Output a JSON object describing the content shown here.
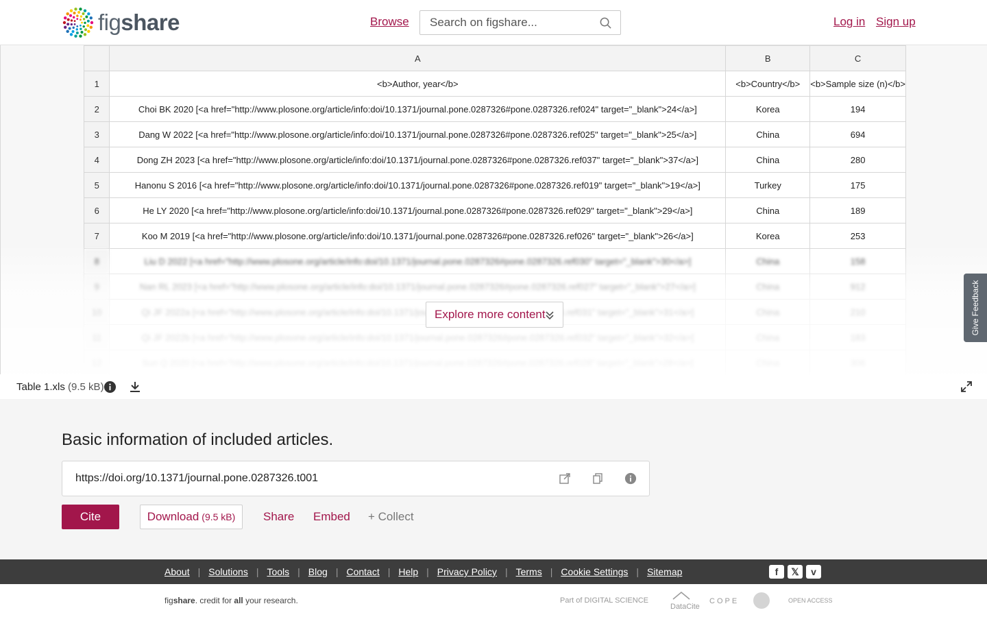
{
  "header": {
    "logo_prefix": "fig",
    "logo_suffix": "share",
    "browse_label": "Browse",
    "search_placeholder": "Search on figshare...",
    "login_label": "Log in",
    "signup_label": "Sign up"
  },
  "sheet": {
    "columns": [
      "A",
      "B",
      "C"
    ],
    "rows": [
      {
        "n": "1",
        "a": "<b>Author, year</b>",
        "b": "<b>Country</b>",
        "c": "<b>Sample size (n)</b>"
      },
      {
        "n": "2",
        "a": "Choi BK 2020 [<a href=\"http://www.plosone.org/article/info:doi/10.1371/journal.pone.0287326#pone.0287326.ref024\" target=\"_blank\">24</a>]",
        "b": "Korea",
        "c": "194"
      },
      {
        "n": "3",
        "a": "Dang W 2022 [<a href=\"http://www.plosone.org/article/info:doi/10.1371/journal.pone.0287326#pone.0287326.ref025\" target=\"_blank\">25</a>]",
        "b": "China",
        "c": "694"
      },
      {
        "n": "4",
        "a": "Dong ZH 2023 [<a href=\"http://www.plosone.org/article/info:doi/10.1371/journal.pone.0287326#pone.0287326.ref037\" target=\"_blank\">37</a>]",
        "b": "China",
        "c": "280"
      },
      {
        "n": "5",
        "a": "Hanonu S 2016 [<a href=\"http://www.plosone.org/article/info:doi/10.1371/journal.pone.0287326#pone.0287326.ref019\" target=\"_blank\">19</a>]",
        "b": "Turkey",
        "c": "175"
      },
      {
        "n": "6",
        "a": "He LY 2020 [<a href=\"http://www.plosone.org/article/info:doi/10.1371/journal.pone.0287326#pone.0287326.ref029\" target=\"_blank\">29</a>]",
        "b": "China",
        "c": "189"
      },
      {
        "n": "7",
        "a": "Koo M 2019 [<a href=\"http://www.plosone.org/article/info:doi/10.1371/journal.pone.0287326#pone.0287326.ref026\" target=\"_blank\">26</a>]",
        "b": "Korea",
        "c": "253"
      }
    ],
    "blurred_rows": [
      {
        "n": "8",
        "a": "Liu D 2022 [<a href=\"http://www.plosone.org/article/info:doi/10.1371/journal.pone.0287326#pone.0287326.ref030\" target=\"_blank\">30</a>]",
        "b": "China",
        "c": "158"
      },
      {
        "n": "9",
        "a": "Nan RL 2023 [<a href=\"http://www.plosone.org/article/info:doi/10.1371/journal.pone.0287326#pone.0287326.ref027\" target=\"_blank\">27</a>]",
        "b": "China",
        "c": "912"
      },
      {
        "n": "10",
        "a": "Qi JF 2022a [<a href=\"http://www.plosone.org/article/info:doi/10.1371/journal.pone.0287326#pone.0287326.ref031\" target=\"_blank\">31</a>]",
        "b": "China",
        "c": "210"
      },
      {
        "n": "11",
        "a": "Qi JF 2022b [<a href=\"http://www.plosone.org/article/info:doi/10.1371/journal.pone.0287326#pone.0287326.ref032\" target=\"_blank\">32</a>]",
        "b": "China",
        "c": "183"
      },
      {
        "n": "12",
        "a": "Sun Q 2020 [<a href=\"http://www.plosone.org/article/info:doi/10.1371/journal.pone.0287326#pone.0287326.ref028\" target=\"_blank\">28</a>]",
        "b": "China",
        "c": "306"
      }
    ]
  },
  "explore_label": "Explore more content",
  "feedback_label": "Give Feedback",
  "file": {
    "name": "Table 1.xls",
    "size": "(9.5 kB)"
  },
  "item": {
    "title": "Basic information of included articles.",
    "doi": "https://doi.org/10.1371/journal.pone.0287326.t001"
  },
  "actions": {
    "cite": "Cite",
    "download": "Download",
    "download_size": "(9.5 kB)",
    "share": "Share",
    "embed": "Embed",
    "collect": "+ Collect"
  },
  "footer": {
    "links": [
      "About",
      "Solutions",
      "Tools",
      "Blog",
      "Contact",
      "Help",
      "Privacy Policy",
      "Terms",
      "Cookie Settings",
      "Sitemap"
    ],
    "credit_prefix": "fig",
    "credit_brand": "share",
    "credit_text_1": ". credit for ",
    "credit_bold": "all",
    "credit_text_2": " your research.",
    "partner_ds": "Part of DIGITAL SCIENCE",
    "partner_datacite": "DataCite",
    "partner_cope": "COPE",
    "partner_oa": "OPEN ACCESS"
  },
  "colors": {
    "brand": "#a2164b",
    "footer_bg": "#3d3d3d"
  }
}
